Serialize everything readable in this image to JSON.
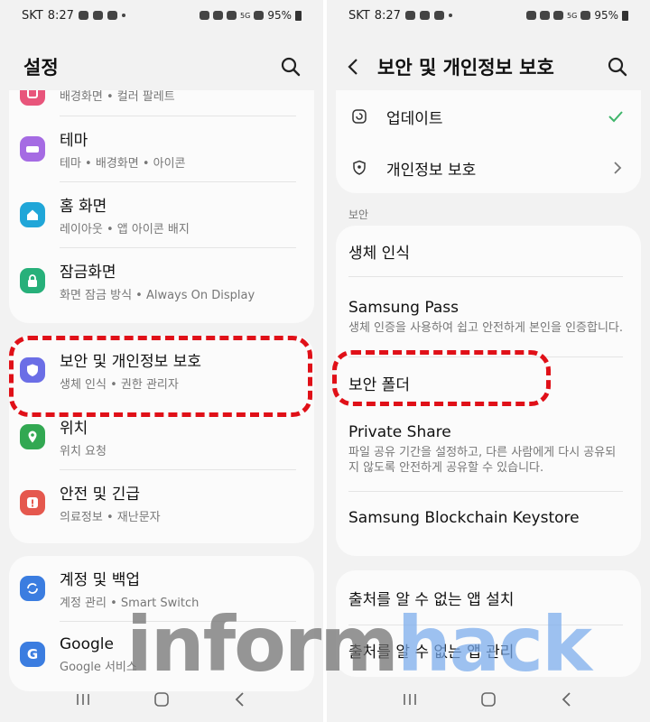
{
  "status_bar": {
    "left": {
      "carrier": "SKT",
      "time": "8:27"
    },
    "right": {
      "network": "5G",
      "battery": "95%"
    }
  },
  "left": {
    "title": "설정",
    "items_card1": [
      {
        "title": "",
        "subtitle": "배경화면 • 컬러 팔레트",
        "icon": "palette-icon",
        "color": "#e8557b"
      },
      {
        "title": "테마",
        "subtitle": "테마 • 배경화면 • 아이콘",
        "icon": "theme-brush-icon",
        "color": "#a56be3"
      },
      {
        "title": "홈 화면",
        "subtitle": "레이아웃 • 앱 아이콘 배지",
        "icon": "home-icon",
        "color": "#20a6d8"
      },
      {
        "title": "잠금화면",
        "subtitle": "화면 잠금 방식 • Always On Display",
        "icon": "lock-icon",
        "color": "#27b07a"
      }
    ],
    "items_card2": [
      {
        "title": "보안 및 개인정보 보호",
        "subtitle": "생체 인식 • 권한 관리자",
        "icon": "shield-icon",
        "color": "#6b6ee6"
      },
      {
        "title": "위치",
        "subtitle": "위치 요청",
        "icon": "location-pin-icon",
        "color": "#32a852"
      },
      {
        "title": "안전 및 긴급",
        "subtitle": "의료정보 • 재난문자",
        "icon": "emergency-icon",
        "color": "#e5584e"
      }
    ],
    "items_card3": [
      {
        "title": "계정 및 백업",
        "subtitle": "계정 관리 • Smart Switch",
        "icon": "sync-icon",
        "color": "#3b7de0"
      },
      {
        "title": "Google",
        "subtitle": "Google 서비스",
        "icon": "google-icon",
        "color": "#3b7de0"
      }
    ]
  },
  "right": {
    "title": "보안 및 개인정보 보호",
    "top_items": [
      {
        "title": "업데이트",
        "icon": "update-icon",
        "trailing": "check-icon"
      },
      {
        "title": "개인정보 보호",
        "icon": "privacy-icon",
        "trailing": "chevron-right-icon"
      }
    ],
    "section_label": "보안",
    "security_items": [
      {
        "title": "생체 인식",
        "subtitle": ""
      },
      {
        "title": "Samsung Pass",
        "subtitle": "생체 인증을 사용하여 쉽고 안전하게 본인을 인증합니다."
      },
      {
        "title": "보안 폴더",
        "subtitle": ""
      },
      {
        "title": "Private Share",
        "subtitle": "파일 공유 기간을 설정하고, 다른 사람에게 다시 공유되지 않도록 안전하게 공유할 수 있습니다."
      },
      {
        "title": "Samsung Blockchain Keystore",
        "subtitle": ""
      }
    ],
    "bottom_items": [
      {
        "title": "출처를 알 수 없는 앱 설치"
      },
      {
        "title": "출처를 알 수 없는 앱 관리"
      }
    ]
  },
  "watermark": {
    "part1": "inform",
    "part2": "hack"
  },
  "colors": {
    "accent_green": "#3fb56b",
    "highlight_red": "#e01018",
    "panel_bg": "#f2f2f2",
    "card_bg": "#fbfbfb"
  }
}
